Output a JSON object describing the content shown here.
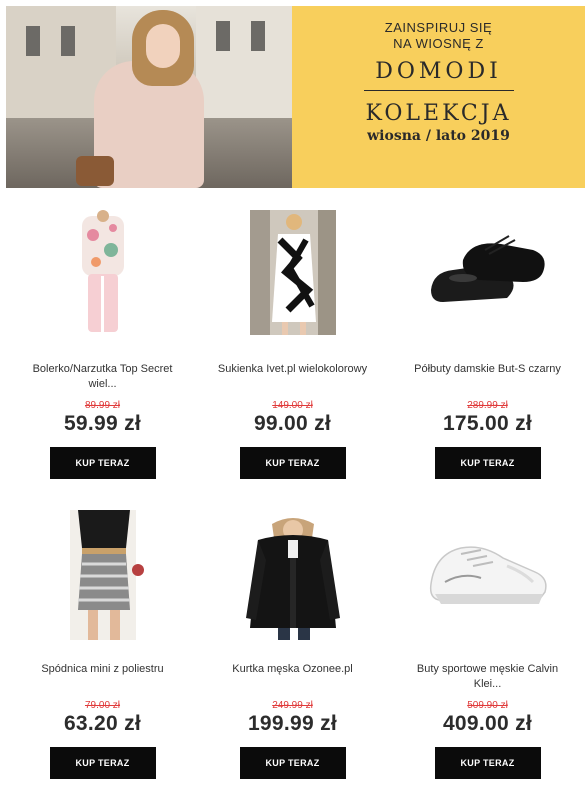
{
  "banner": {
    "line1": "ZAINSPIRUJ SIĘ",
    "line2": "NA WIOSNĘ Z",
    "brand": "DOMODI",
    "collection": "KOLEKCJA",
    "season": "wiosna / lato 2019",
    "background_color": "#f8cf5c"
  },
  "buy_label": "KUP TERAZ",
  "colors": {
    "old_price": "#e03b3b",
    "button": "#0b0b0b"
  },
  "products": [
    {
      "name": "Bolerko/Narzutka Top Secret wiel...",
      "old_price": "89.99 zł",
      "price": "59.99 zł",
      "image": "floral-coat-image"
    },
    {
      "name": "Sukienka Ivet.pl wielokolorowy",
      "old_price": "149.00 zł",
      "price": "99.00 zł",
      "image": "patterned-dress-image"
    },
    {
      "name": "Półbuty damskie But-S czarny",
      "old_price": "289.99 zł",
      "price": "175.00 zł",
      "image": "black-shoes-image"
    },
    {
      "name": "Spódnica mini z poliestru",
      "old_price": "79.00 zł",
      "price": "63.20 zł",
      "image": "mini-skirt-image"
    },
    {
      "name": "Kurtka męska Ozonee.pl",
      "old_price": "249.99 zł",
      "price": "199.99 zł",
      "image": "mens-jacket-image"
    },
    {
      "name": "Buty sportowe męskie Calvin Klei...",
      "old_price": "509.90 zł",
      "price": "409.00 zł",
      "image": "white-sneaker-image"
    }
  ]
}
